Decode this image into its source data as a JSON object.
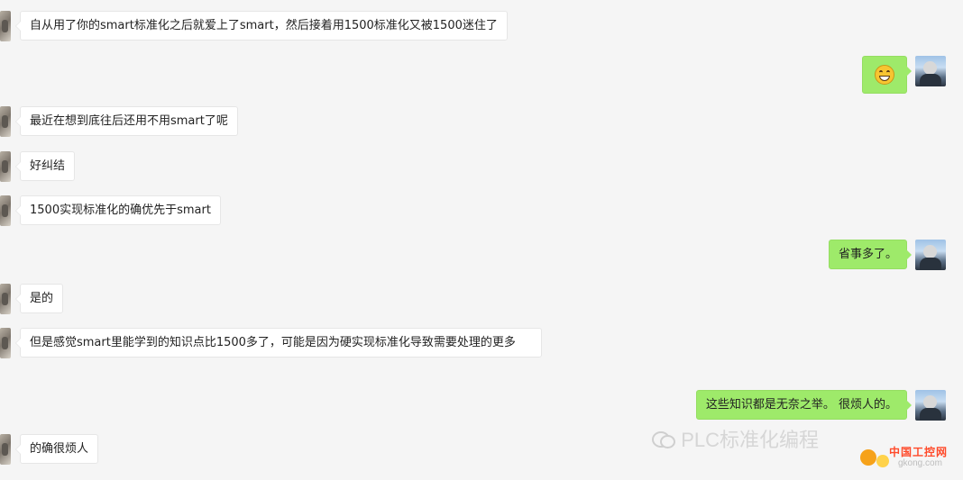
{
  "messages": [
    {
      "side": "left",
      "text": "自从用了你的smart标准化之后就爱上了smart，然后接着用1500标准化又被1500迷住了"
    },
    {
      "side": "right",
      "emoji": "grinning-face"
    },
    {
      "side": "left",
      "text": "最近在想到底往后还用不用smart了呢"
    },
    {
      "side": "left",
      "text": "好纠结"
    },
    {
      "side": "left",
      "text": "1500实现标准化的确优先于smart"
    },
    {
      "side": "right",
      "text": "省事多了。"
    },
    {
      "side": "left",
      "text": "是的"
    },
    {
      "side": "left",
      "text": "但是感觉smart里能学到的知识点比1500多了，可能是因为硬实现标准化导致需要处理的更多"
    },
    {
      "side": "right",
      "text": "这些知识都是无奈之举。 很烦人的。"
    },
    {
      "side": "left",
      "text": "的确很烦人"
    }
  ],
  "watermark": {
    "text": "PLC标准化编程",
    "site_brand": "中国工控网",
    "site_url": "gkong.com"
  },
  "colors": {
    "background": "#f5f5f5",
    "incoming_bubble": "#ffffff",
    "outgoing_bubble": "#9eea6a"
  }
}
